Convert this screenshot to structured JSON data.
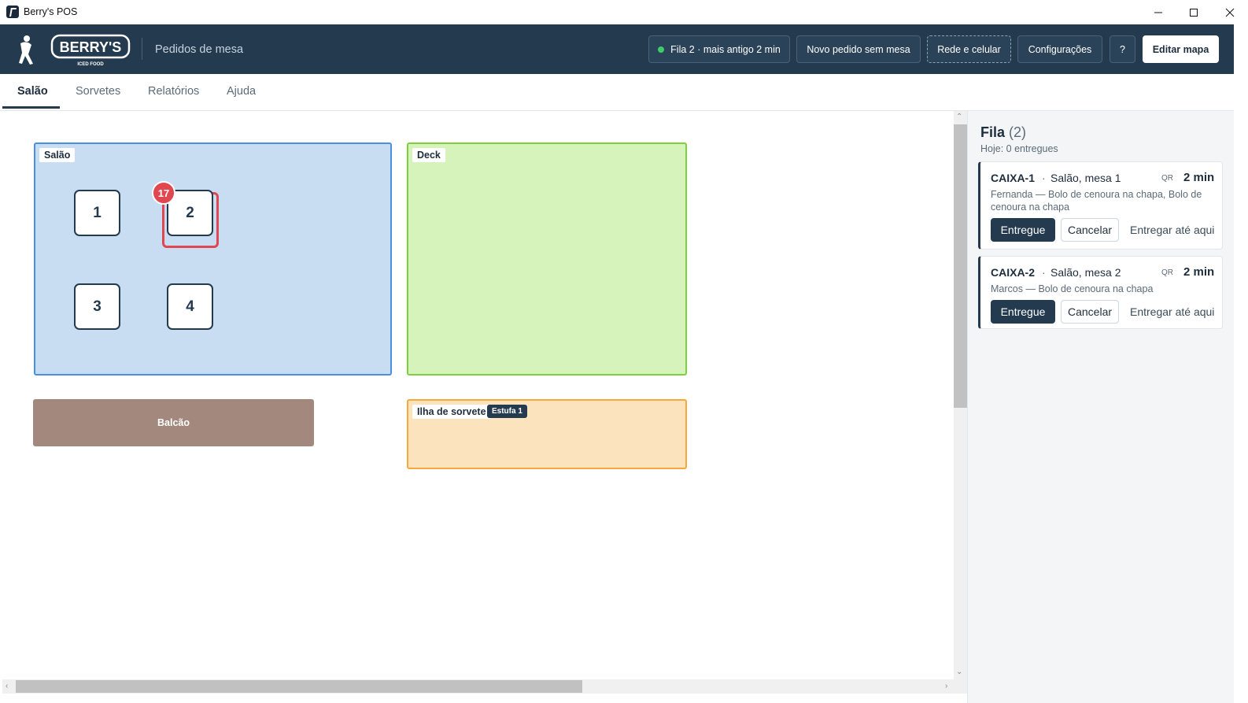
{
  "window": {
    "title": "Berry's POS"
  },
  "header": {
    "logo_text": "BERRY'S",
    "logo_tagline": "ICED FOOD",
    "subtitle": "Pedidos de mesa",
    "status_button": "Fila 2 · mais antigo 2 min",
    "new_order_button": "Novo pedido sem mesa",
    "network_button": "Rede e celular",
    "settings_button": "Configurações",
    "help_button": "?",
    "edit_map_button": "Editar mapa",
    "status_color": "#3fcb6a"
  },
  "tabs": [
    {
      "label": "Salão",
      "active": true
    },
    {
      "label": "Sorvetes",
      "active": false
    },
    {
      "label": "Relatórios",
      "active": false
    },
    {
      "label": "Ajuda",
      "active": false
    }
  ],
  "map": {
    "zones": {
      "salao": {
        "label": "Salão",
        "color": "#c8dcf2"
      },
      "deck": {
        "label": "Deck",
        "color": "#d7f3bc"
      },
      "balcao": {
        "label": "Balcão",
        "color": "#a3887d"
      },
      "ilha": {
        "label": "Ilha de sorvete",
        "chip": "Estufa 1",
        "color": "#fbe3bd"
      }
    },
    "tables": [
      {
        "number": "1"
      },
      {
        "number": "2",
        "badge": "17",
        "alert": true
      },
      {
        "number": "3"
      },
      {
        "number": "4"
      }
    ]
  },
  "queue": {
    "title": "Fila",
    "count": "(2)",
    "today": "Hoje: 0 entregues",
    "orders": [
      {
        "id": "CAIXA-1",
        "sep": "·",
        "location": "Salão, mesa 1",
        "source": "QR",
        "time": "2 min",
        "customer": "Fernanda",
        "dash": "—",
        "items": "Bolo de cenoura na chapa, Bolo de cenoura na chapa",
        "deliver_label": "Entregue",
        "cancel_label": "Cancelar",
        "deliver_here_label": "Entregar até aqui"
      },
      {
        "id": "CAIXA-2",
        "sep": "·",
        "location": "Salão, mesa 2",
        "source": "QR",
        "time": "2 min",
        "customer": "Marcos",
        "dash": "—",
        "items": "Bolo de cenoura na chapa",
        "deliver_label": "Entregue",
        "cancel_label": "Cancelar",
        "deliver_here_label": "Entregar até aqui"
      }
    ]
  },
  "colors": {
    "primary": "#233a4f",
    "alert": "#e0474f"
  }
}
